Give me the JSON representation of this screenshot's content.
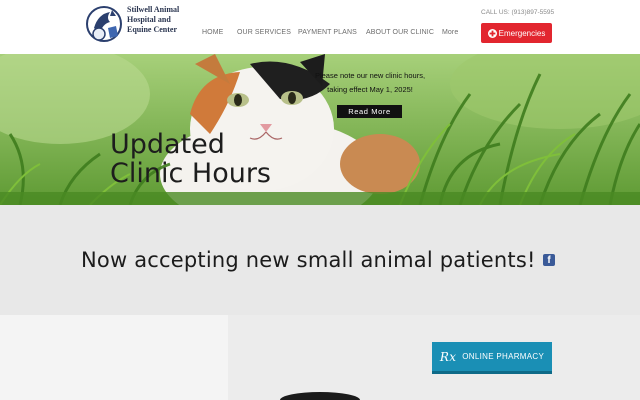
{
  "header": {
    "logo_lines": [
      "Stilwell Animal",
      "Hospital and",
      "Equine Center"
    ],
    "nav": [
      "HOME",
      "OUR SERVICES",
      "PAYMENT PLANS",
      "ABOUT OUR CLINIC",
      "More"
    ],
    "call_text": "CALL US: (913)897-5595",
    "emergency_label": "Emergencies"
  },
  "hero": {
    "title_lines": [
      "Updated",
      "Clinic Hours"
    ],
    "note_lines": [
      "Please note our new clinic hours,",
      "taking effect May 1, 2025!"
    ],
    "read_more_label": "Read More"
  },
  "banner": {
    "text": "Now accepting new small animal patients!",
    "fb_label": "f"
  },
  "lower": {
    "pharmacy_icon": "Rx",
    "pharmacy_label": "ONLINE PHARMACY"
  },
  "colors": {
    "emergency": "#e2262f",
    "pharmacy": "#1a8fb5",
    "facebook": "#3a5a98"
  },
  "icons": [
    "logo-emblem",
    "red-cross-icon",
    "facebook-icon",
    "rx-icon"
  ]
}
